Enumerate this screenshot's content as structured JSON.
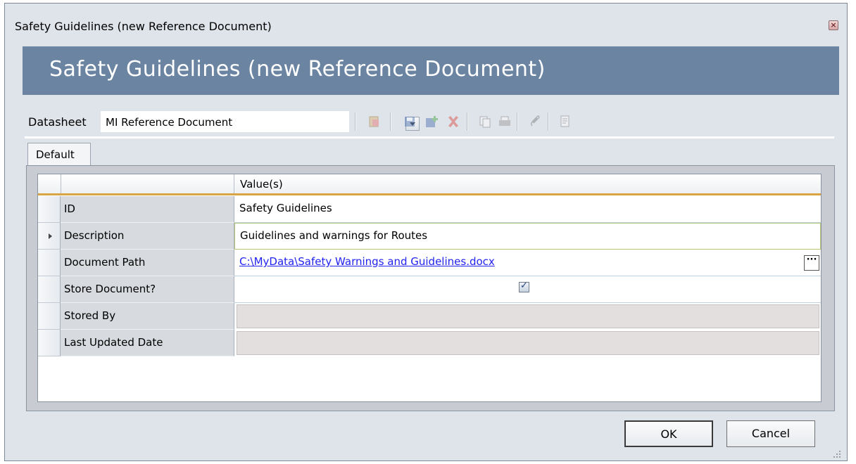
{
  "window": {
    "title": "Safety Guidelines (new Reference Document)",
    "close_icon": "close-icon"
  },
  "banner": {
    "heading": "Safety Guidelines (new Reference Document)"
  },
  "toolbar": {
    "datasheet_label": "Datasheet",
    "datasheet_value": "MI Reference Document",
    "icons": [
      "open-document-icon",
      "save-icon",
      "save-new-icon",
      "delete-icon",
      "copy-icon",
      "print-icon",
      "attachment-icon",
      "report-icon"
    ]
  },
  "tabs": [
    {
      "label": "Default"
    }
  ],
  "grid": {
    "header": {
      "value_col": "Value(s)"
    },
    "rows": [
      {
        "field": "ID",
        "value": "Safety Guidelines"
      },
      {
        "field": "Description",
        "value": "Guidelines and warnings for Routes"
      },
      {
        "field": "Document Path",
        "value": "C:\\MyData\\Safety Warnings and Guidelines.docx",
        "button": "···"
      },
      {
        "field": "Store Document?",
        "value": "",
        "checked": true
      },
      {
        "field": "Stored By",
        "value": ""
      },
      {
        "field": "Last Updated Date",
        "value": ""
      }
    ]
  },
  "buttons": {
    "ok": "OK",
    "cancel": "Cancel"
  }
}
